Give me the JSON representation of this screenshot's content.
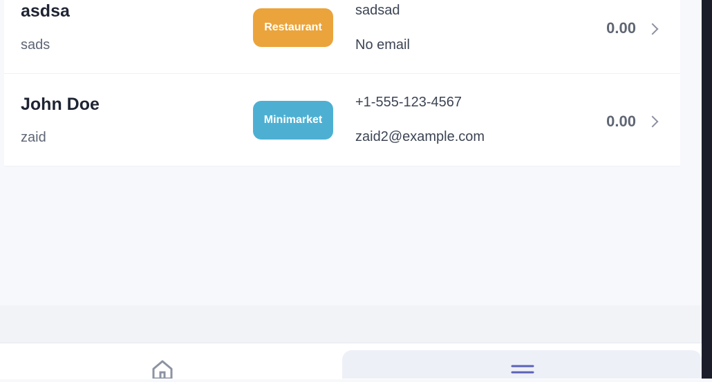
{
  "rows": [
    {
      "name": "asdsa",
      "subtitle": "sads",
      "badge": "Restaurant",
      "badge_color": "#eba43b",
      "contact_primary": "sadsad",
      "contact_secondary": "No email",
      "amount": "0.00"
    },
    {
      "name": "John Doe",
      "subtitle": "zaid",
      "badge": "Minimarket",
      "badge_color": "#4db0d3",
      "contact_primary": "+1-555-123-4567",
      "contact_secondary": "zaid2@example.com",
      "amount": "0.00"
    }
  ],
  "nav": {
    "items": [
      {
        "icon": "home-icon"
      },
      {
        "icon": "menu-icon"
      }
    ]
  }
}
